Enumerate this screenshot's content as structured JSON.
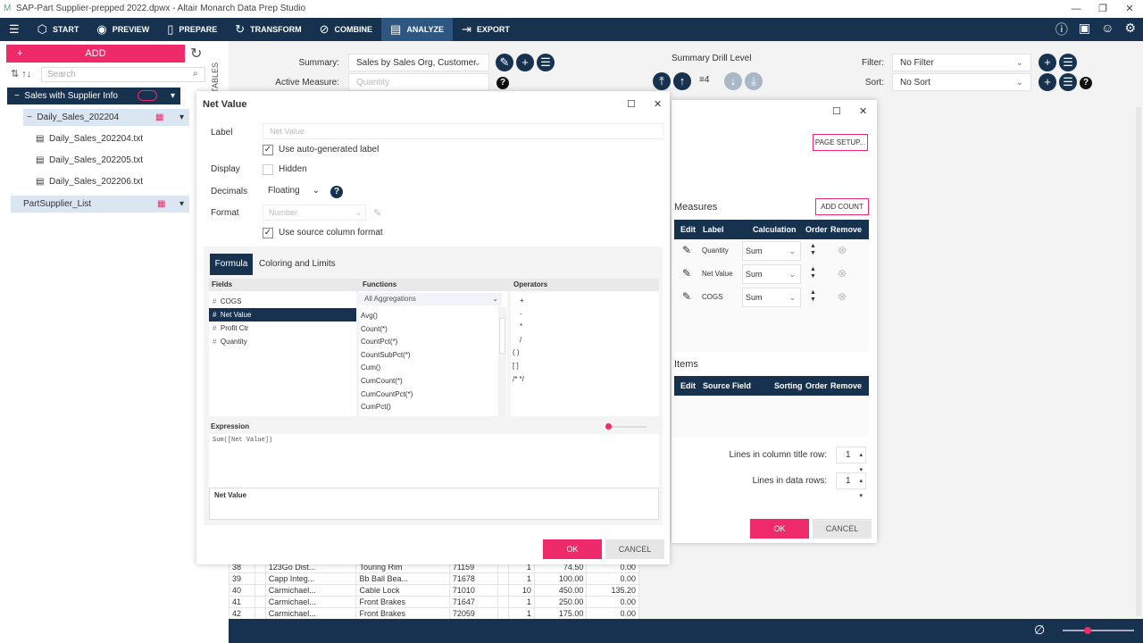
{
  "window": {
    "title": "SAP-Part Supplier-prepped 2022.dpwx - Altair Monarch Data Prep Studio"
  },
  "nav": {
    "items": [
      {
        "label": "START",
        "icon": "cube-icon"
      },
      {
        "label": "PREVIEW",
        "icon": "eye-icon"
      },
      {
        "label": "PREPARE",
        "icon": "columns-icon"
      },
      {
        "label": "TRANSFORM",
        "icon": "cycle-icon"
      },
      {
        "label": "COMBINE",
        "icon": "combine-icon"
      },
      {
        "label": "ANALYZE",
        "icon": "clipboard-icon",
        "active": true
      },
      {
        "label": "EXPORT",
        "icon": "export-icon"
      }
    ]
  },
  "left": {
    "add_label": "ADD",
    "tables_label": "TABLES",
    "search_placeholder": "Search",
    "tree": [
      {
        "label": "Sales with Supplier Info"
      },
      {
        "label": "Daily_Sales_202204"
      },
      {
        "label": "Daily_Sales_202204.txt"
      },
      {
        "label": "Daily_Sales_202205.txt"
      },
      {
        "label": "Daily_Sales_202206.txt"
      },
      {
        "label": "PartSupplier_List"
      }
    ]
  },
  "summary_bar": {
    "summary_label": "Summary:",
    "summary_value": "Sales by Sales Org, Customer",
    "active_measure_label": "Active Measure:",
    "active_measure_value": "Quantity",
    "drill_label": "Summary Drill Level",
    "drill_level": "4",
    "filter_label": "Filter:",
    "filter_value": "No Filter",
    "sort_label": "Sort:",
    "sort_value": "No Sort"
  },
  "measure_dialog": {
    "title": "Net Value",
    "label_label": "Label",
    "label_value": "Net Value",
    "auto_label": "Use auto-generated label",
    "auto_checked": true,
    "display_label": "Display",
    "hidden_label": "Hidden",
    "hidden_checked": false,
    "decimals_label": "Decimals",
    "decimals_value": "Floating",
    "format_label": "Format",
    "format_value": "Number",
    "source_format_label": "Use source column format",
    "source_format_checked": true,
    "tabs": [
      "Formula",
      "Coloring and Limits"
    ],
    "fields_header": "Fields",
    "functions_header": "Functions",
    "operators_header": "Operators",
    "fields": [
      "COGS",
      "Net Value",
      "Profit Ctr",
      "Quantity"
    ],
    "functions_filter": "All Aggregations",
    "functions": [
      "Avg()",
      "Count(*)",
      "CountPct(*)",
      "CountSubPct(*)",
      "Cum()",
      "CumCount(*)",
      "CumCountPct(*)",
      "CumPct()"
    ],
    "operators": [
      "+",
      "-",
      "*",
      "/",
      "( )",
      "[ ]",
      "/* */"
    ],
    "expression_label": "Expression",
    "expression": "Sum([Net Value])",
    "result_label": "Net Value",
    "ok": "OK",
    "cancel": "CANCEL"
  },
  "summary_dialog": {
    "page_setup": "PAGE SETUP...",
    "measures_label": "Measures",
    "add_count": "ADD COUNT",
    "measures_headers": [
      "Edit",
      "Label",
      "Calculation",
      "Order",
      "Remove"
    ],
    "measures": [
      {
        "label": "Quantity",
        "calc": "Sum"
      },
      {
        "label": "Net Value",
        "calc": "Sum"
      },
      {
        "label": "COGS",
        "calc": "Sum"
      }
    ],
    "items_label": "Items",
    "items_headers": [
      "Edit",
      "Source Field",
      "Sorting",
      "Order",
      "Remove"
    ],
    "lines_title_label": "Lines in column title row:",
    "lines_title_value": "1",
    "lines_data_label": "Lines in data rows:",
    "lines_data_value": "1",
    "ok": "OK",
    "cancel": "CANCEL"
  },
  "data_rows": [
    [
      "38",
      "123Go Dist...",
      "Touring Rim",
      "71159",
      "1",
      "74.50",
      "0.00"
    ],
    [
      "39",
      "Capp Integ...",
      "Bb Ball Bea...",
      "71678",
      "1",
      "100.00",
      "0.00"
    ],
    [
      "40",
      "Carmichael...",
      "Cable Lock",
      "71010",
      "10",
      "450.00",
      "135.20"
    ],
    [
      "41",
      "Carmichael...",
      "Front Brakes",
      "71647",
      "1",
      "250.00",
      "0.00"
    ],
    [
      "42",
      "Carmichael...",
      "Front Brakes",
      "72059",
      "1",
      "175.00",
      "0.00"
    ]
  ],
  "colors": {
    "navy": "#16324f",
    "accent": "#ee2a6b"
  }
}
